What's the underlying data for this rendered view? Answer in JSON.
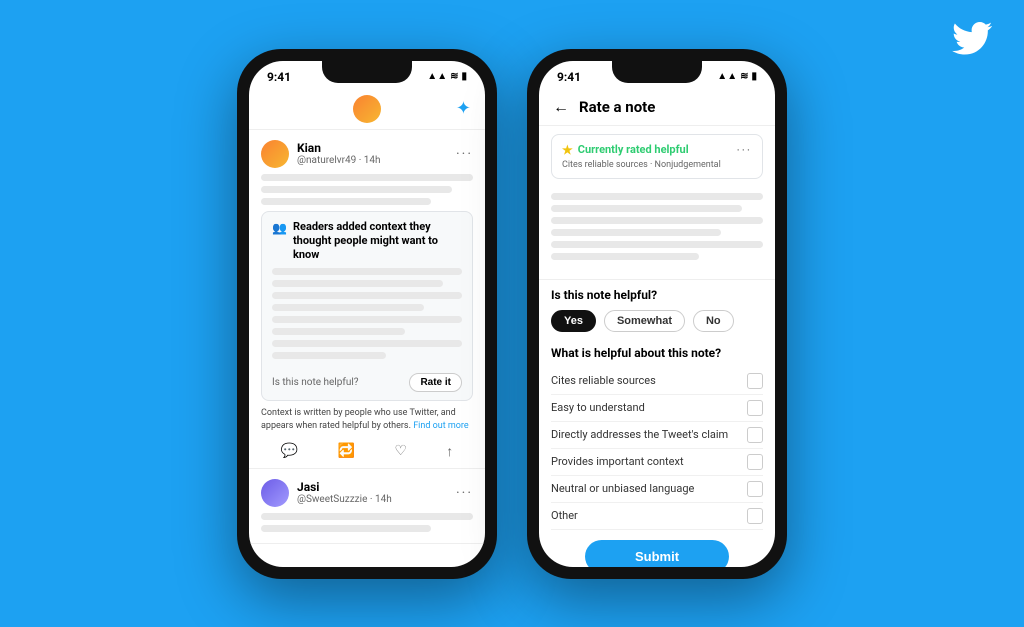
{
  "background_color": "#1DA1F2",
  "twitter_logo": "🐦",
  "phone1": {
    "status_time": "9:41",
    "status_icons": "▲▲ ❍ ■",
    "topbar_sparkle": "✦",
    "tweet1": {
      "user_name": "Kian",
      "user_handle": "@naturelvr49 · 14h",
      "context_note_title": "Readers added context they thought people might want to know",
      "helpful_question": "Is this note helpful?",
      "rate_button": "Rate it",
      "context_footer": "Context is written by people who use Twitter, and appears when rated helpful by others.",
      "find_out_more": "Find out more"
    },
    "tweet2": {
      "user_name": "Jasi",
      "user_handle": "@SweetSuzzzie · 14h"
    }
  },
  "phone2": {
    "status_time": "9:41",
    "status_icons": "▲▲ ❍ ■",
    "header": {
      "back_label": "←",
      "title": "Rate a note"
    },
    "rated_box": {
      "status": "Currently rated helpful",
      "tags": "Cites reliable sources · Nonjudgemental"
    },
    "helpful_question": "Is this note helpful?",
    "rating_options": [
      {
        "label": "Yes",
        "selected": true
      },
      {
        "label": "Somewhat",
        "selected": false
      },
      {
        "label": "No",
        "selected": false
      }
    ],
    "helpful_about_title": "What is helpful about this note?",
    "checkboxes": [
      {
        "label": "Cites reliable sources",
        "checked": false
      },
      {
        "label": "Easy to understand",
        "checked": false
      },
      {
        "label": "Directly addresses the Tweet's claim",
        "checked": false
      },
      {
        "label": "Provides important context",
        "checked": false
      },
      {
        "label": "Neutral or unbiased language",
        "checked": false
      },
      {
        "label": "Other",
        "checked": false
      }
    ],
    "submit_button": "Submit"
  }
}
